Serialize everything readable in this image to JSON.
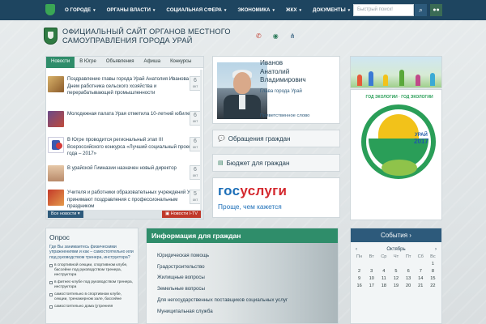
{
  "topnav": {
    "items": [
      "О ГОРОДЕ",
      "ОРГАНЫ ВЛАСТИ",
      "СОЦИАЛЬНАЯ СФЕРА",
      "ЭКОНОМИКА",
      "ЖКХ",
      "ДОКУМЕНТЫ"
    ],
    "search_placeholder": "Быстрый поиск!"
  },
  "header": {
    "title_line1": "ОФИЦИАЛЬНЫЙ САЙТ ОРГАНОВ МЕСТНОГО",
    "title_line2": "САМОУПРАВЛЕНИЯ ГОРОДА УРАЙ",
    "icons": [
      "phone-icon",
      "eye-icon",
      "sitemap-icon"
    ]
  },
  "news": {
    "tabs": [
      "Новости",
      "В Югре",
      "Объявления",
      "Афиша",
      "Конкурсы"
    ],
    "items": [
      {
        "text": "Поздравление главы города Урай Анатолия Иванова с Днем работника сельского хозяйства и перерабатывающей промышленности",
        "day": "6",
        "month": "окт"
      },
      {
        "text": "Молодежная палата Урая отметила 10-летний юбилей",
        "day": "6",
        "month": "окт"
      },
      {
        "text": "В Югре проводится региональный этап III Всероссийского конкурса «Лучший социальный проект года – 2017»",
        "day": "6",
        "month": "окт"
      },
      {
        "text": "В урайской Гимназии назначен новый директор",
        "day": "6",
        "month": "окт"
      },
      {
        "text": "Учителя и работники образовательных учреждений Урая принимают поздравления с профессиональным праздником",
        "day": "5",
        "month": "окт"
      }
    ],
    "all_news": "Все новости",
    "tv_news": "Новости I-TV"
  },
  "mayor": {
    "surname": "Иванов",
    "name": "Анатолий",
    "patronymic": "Владимирович",
    "role": "Глава города Урай",
    "link": "Приветственное слово"
  },
  "buttons": {
    "appeals": "Обращения граждан",
    "budget": "Бюджет для граждан"
  },
  "gosuslugi": {
    "logo_a": "гос",
    "logo_b": "услуги",
    "slogan": "Проще, чем кажется"
  },
  "eco_banner": {
    "arc": "ГОД ЭКОЛОГИИ · ГОД ЭКОЛОГИИ",
    "city": "УРАЙ",
    "year": "2017"
  },
  "poll": {
    "title": "Опрос",
    "question": "Где Вы занимаетесь физическими упражнениями и как – самостоятельно или под руководством тренера, инструктора?",
    "options": [
      "в спортивной секции, спортивном клубе, бассейне под руководством тренера, инструктора",
      "в фитнес-клубе под руководством тренера, инструктора",
      "самостоятельно в спортивном клубе, секции, тренажерном зале, бассейне",
      "самостоятельно дома (утренняя"
    ]
  },
  "info": {
    "title": "Информация для граждан",
    "links": [
      "Юридическая помощь",
      "Градостроительство",
      "Жилищные вопросы",
      "Земельные вопросы",
      "Для негосударственных поставщиков социальных услуг",
      "Муниципальная служба"
    ]
  },
  "events": {
    "title": "События ›",
    "month": "Октябрь",
    "days": [
      "Пн",
      "Вт",
      "Ср",
      "Чт",
      "Пт",
      "Сб",
      "Вс"
    ],
    "dates": [
      "",
      "",
      "",
      "",
      "",
      "",
      "1",
      "2",
      "3",
      "4",
      "5",
      "6",
      "7",
      "8",
      "9",
      "10",
      "11",
      "12",
      "13",
      "14",
      "15",
      "16",
      "17",
      "18",
      "19",
      "20",
      "21",
      "22"
    ]
  }
}
